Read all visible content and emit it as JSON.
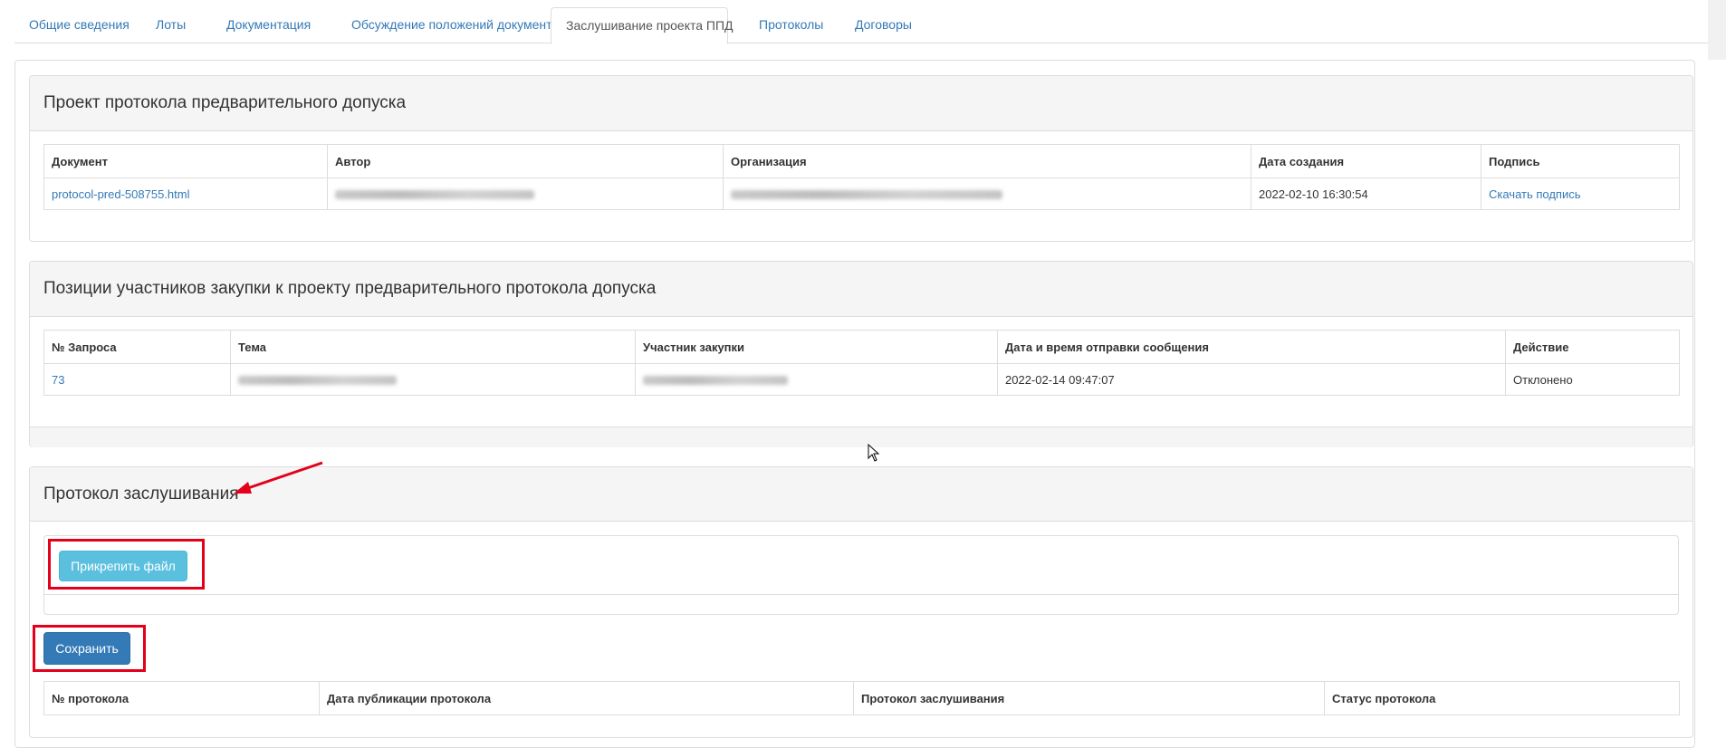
{
  "tabs": [
    {
      "label": "Общие сведения",
      "active": false
    },
    {
      "label": "Лоты",
      "active": false
    },
    {
      "label": "Документация",
      "active": false
    },
    {
      "label": "Обсуждение положений документации",
      "active": false
    },
    {
      "label": "Заслушивание проекта ППД",
      "active": true
    },
    {
      "label": "Протоколы",
      "active": false
    },
    {
      "label": "Договоры",
      "active": false
    }
  ],
  "project_panel": {
    "title": "Проект протокола предварительного допуска",
    "columns": [
      "Документ",
      "Автор",
      "Организация",
      "Дата создания",
      "Подпись"
    ],
    "row": {
      "document": "protocol-pred-508755.html",
      "created": "2022-02-10 16:30:54",
      "signature_link": "Скачать подпись"
    }
  },
  "positions_panel": {
    "title": "Позиции участников закупки к проекту предварительного протокола допуска",
    "columns": [
      "№ Запроса",
      "Тема",
      "Участник закупки",
      "Дата и время отправки сообщения",
      "Действие"
    ],
    "row": {
      "request_no": "73",
      "sent_at": "2022-02-14 09:47:07",
      "action": "Отклонено"
    }
  },
  "hearing_panel": {
    "title": "Протокол заслушивания",
    "attach_button": "Прикрепить файл",
    "save_button": "Сохранить",
    "columns": [
      "№ протокола",
      "Дата публикации протокола",
      "Протокол заслушивания",
      "Статус протокола"
    ]
  },
  "colors": {
    "link": "#337ab7",
    "attach_button": "#5bc0de",
    "save_button": "#337ab7",
    "annotation_red": "#e3001b"
  }
}
